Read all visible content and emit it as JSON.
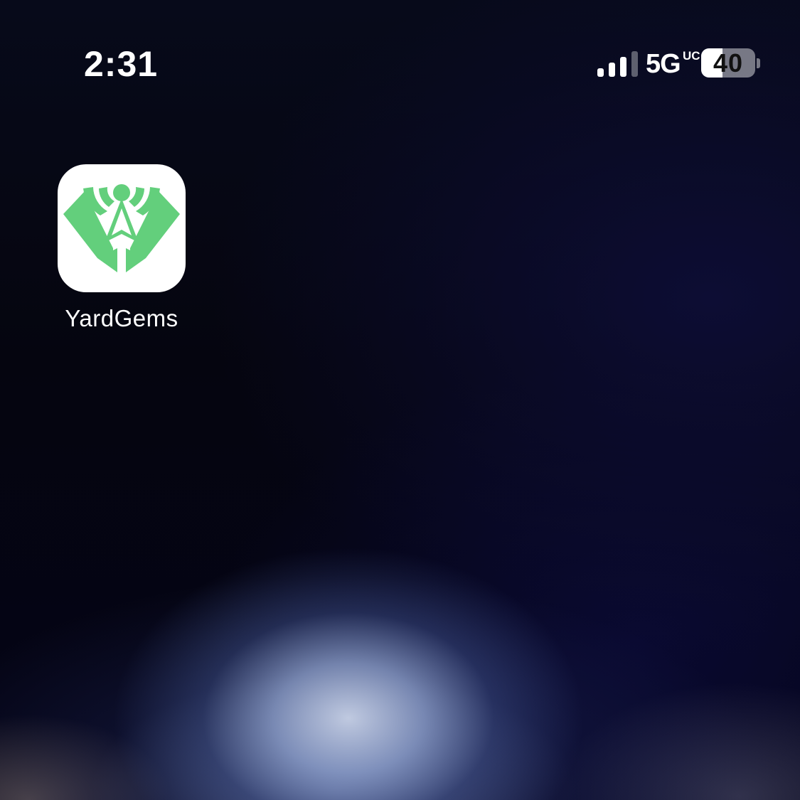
{
  "status_bar": {
    "time": "2:31",
    "signal_bars": 4,
    "signal_strength": 3,
    "network": "5G",
    "network_suffix": "UC",
    "battery_percent": 40,
    "battery_label": "40"
  },
  "home_screen": {
    "apps": [
      {
        "label": "YardGems",
        "icon": "yardgems-app-icon",
        "brand_color": "#63cf7c"
      }
    ]
  }
}
